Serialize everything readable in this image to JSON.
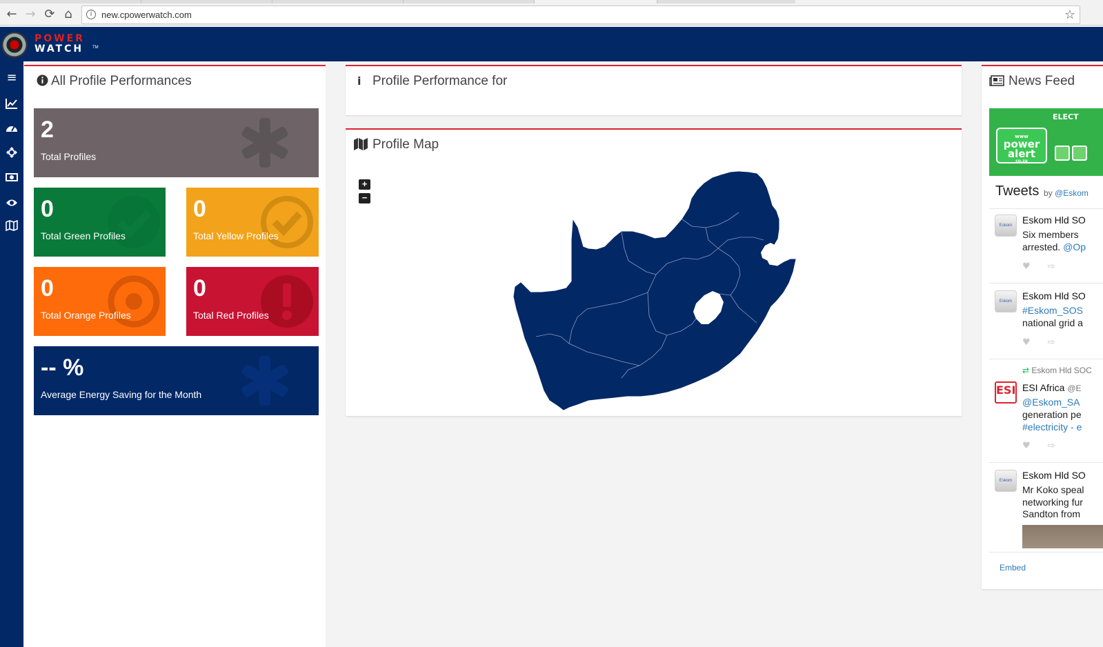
{
  "browser": {
    "url": "new.cpowerwatch.com",
    "back_icon": "←",
    "forward_icon": "→",
    "reload_icon": "⟳",
    "home_icon": "⌂",
    "info_icon": "i",
    "star_icon": "☆"
  },
  "logo": {
    "line1": "POWER",
    "line2": "WATCH",
    "tm": "TM"
  },
  "sidebar": {
    "items": [
      {
        "name": "menu-icon",
        "glyph": "≡"
      },
      {
        "name": "chart-line-icon",
        "glyph": "📈"
      },
      {
        "name": "dashboard-icon",
        "glyph": "◔"
      },
      {
        "name": "crosshair-icon",
        "glyph": "✥"
      },
      {
        "name": "money-icon",
        "glyph": "▣"
      },
      {
        "name": "eye-icon",
        "glyph": "◉"
      },
      {
        "name": "map-icon",
        "glyph": "▥"
      }
    ]
  },
  "all_profiles": {
    "title": "All Profile Performances",
    "icon": "i",
    "tiles": [
      {
        "value": "2",
        "label": "Total Profiles",
        "color": "#6e6468",
        "ghost": "asterisk"
      },
      {
        "value": "0",
        "label": "Total Green Profiles",
        "color": "#0a7a3a",
        "ghost": "check"
      },
      {
        "value": "0",
        "label": "Total Yellow Profiles",
        "color": "#f2a31b",
        "ghost": "check"
      },
      {
        "value": "0",
        "label": "Total Orange Profiles",
        "color": "#fd6b0a",
        "ghost": "target"
      },
      {
        "value": "0",
        "label": "Total Red Profiles",
        "color": "#c91332",
        "ghost": "exclamation"
      },
      {
        "value": "-- %",
        "label": "Average Energy Saving for the Month",
        "color": "#032866",
        "ghost": "asterisk"
      }
    ]
  },
  "profile_performance": {
    "title": "Profile Performance for",
    "icon": "i"
  },
  "profile_map": {
    "title": "Profile Map",
    "zoom_in": "+",
    "zoom_out": "−",
    "map_color": "#032866"
  },
  "news_feed": {
    "title": "News Feed",
    "banner": {
      "line1": "www",
      "line2": "power",
      "line3": "alert",
      "line4": "co.za",
      "elect": "ELECT"
    },
    "tweets_title": "Tweets",
    "tweets_by": "by",
    "tweets_handle": "@Eskom",
    "tweets": [
      {
        "author": "Eskom Hld SO",
        "lines": [
          "Six members",
          "arrested. "
        ],
        "link_tail": "@Op",
        "avatar": "Eskom"
      },
      {
        "author": "Eskom Hld SO",
        "link_line": "#Eskom_SOS",
        "lines": [
          "national grid a"
        ],
        "avatar": "Eskom"
      },
      {
        "retweet_by": "Eskom Hld SOC",
        "author": "ESI Africa",
        "handle": "@E",
        "link_line": "@Eskom_SA",
        "lines": [
          "generation pe"
        ],
        "link_line2": "#electricity",
        "link_line2_tail": " - e",
        "avatar": "ESI"
      },
      {
        "author": "Eskom Hld SO",
        "lines": [
          "Mr Koko speal",
          "networking fur",
          "Sandton from"
        ],
        "avatar": "Eskom"
      }
    ],
    "embed": "Embed",
    "heart": "♥",
    "share": "⇨"
  }
}
